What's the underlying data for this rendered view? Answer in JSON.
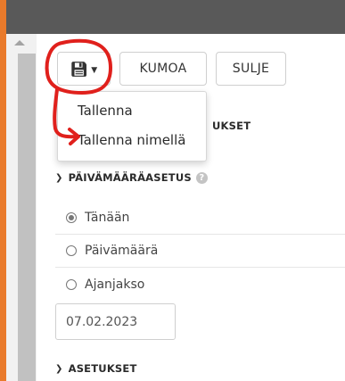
{
  "toolbar": {
    "save_icon": "save-icon",
    "undo_label": "KUMOA",
    "close_label": "SULJE"
  },
  "dropdown": {
    "items": [
      {
        "label": "Tallenna"
      },
      {
        "label": "Tallenna nimellä"
      }
    ]
  },
  "sections": {
    "hidden_partial": "UKSET",
    "date_setting": "PÄIVÄMÄÄRÄASETUS",
    "settings": "ASETUKSET"
  },
  "date_options": [
    {
      "label": "Tänään",
      "checked": true
    },
    {
      "label": "Päivämäärä",
      "checked": false
    },
    {
      "label": "Ajanjakso",
      "checked": false
    }
  ],
  "date_input": {
    "value": "07.02.2023"
  },
  "colors": {
    "window_border": "#e97a2b",
    "top_bar": "#595959",
    "annotation": "#e0201c"
  }
}
